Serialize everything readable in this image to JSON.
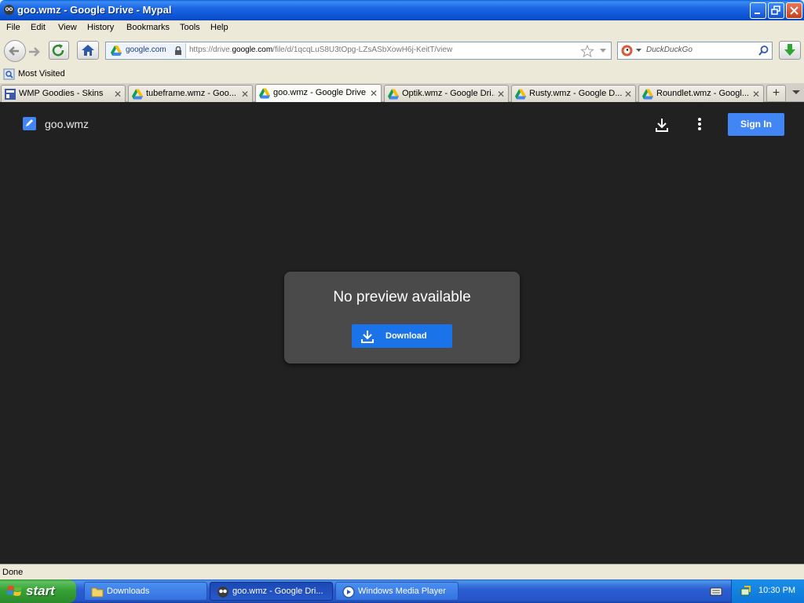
{
  "window": {
    "title": "goo.wmz - Google Drive - Mypal"
  },
  "menu": [
    "File",
    "Edit",
    "View",
    "History",
    "Bookmarks",
    "Tools",
    "Help"
  ],
  "navbar": {
    "site_identity": "google.com",
    "url_prefix": "https://drive.",
    "url_domain": "google.com",
    "url_path": "/file/d/1qcqLuS8U3tOpg-LZsASbXowH6j-KeitT/view",
    "search_placeholder": "DuckDuckGo"
  },
  "bookmarks": {
    "most_visited": "Most Visited"
  },
  "tabs": [
    {
      "label": "WMP Goodies - Skins",
      "icon": "wmp-goodies-icon",
      "active": false
    },
    {
      "label": "tubeframe.wmz - Goo...",
      "icon": "google-drive-icon",
      "active": false
    },
    {
      "label": "goo.wmz - Google Drive",
      "icon": "google-drive-icon",
      "active": true
    },
    {
      "label": "Optik.wmz - Google Dri...",
      "icon": "google-drive-icon",
      "active": false
    },
    {
      "label": "Rusty.wmz - Google D...",
      "icon": "google-drive-icon",
      "active": false
    },
    {
      "label": "Roundlet.wmz - Googl...",
      "icon": "google-drive-icon",
      "active": false
    }
  ],
  "drive": {
    "file_name": "goo.wmz",
    "sign_in": "Sign In",
    "no_preview": "No preview available",
    "download": "Download"
  },
  "status": {
    "text": "Done"
  },
  "taskbar": {
    "start": "start",
    "tasks": [
      {
        "label": "Downloads",
        "icon": "folder-icon"
      },
      {
        "label": "goo.wmz - Google Dri...",
        "icon": "mypal-icon"
      },
      {
        "label": "Windows Media Player",
        "icon": "windows-media-player-icon"
      }
    ],
    "clock": "10:30 PM"
  },
  "colors": {
    "drive_bg": "#212121",
    "card_bg": "#4a4a4a",
    "accent_blue": "#1a73e8",
    "signin_blue": "#4285f4",
    "xp_title_blue": "#0b52d2",
    "xp_start_green": "#36a336"
  }
}
